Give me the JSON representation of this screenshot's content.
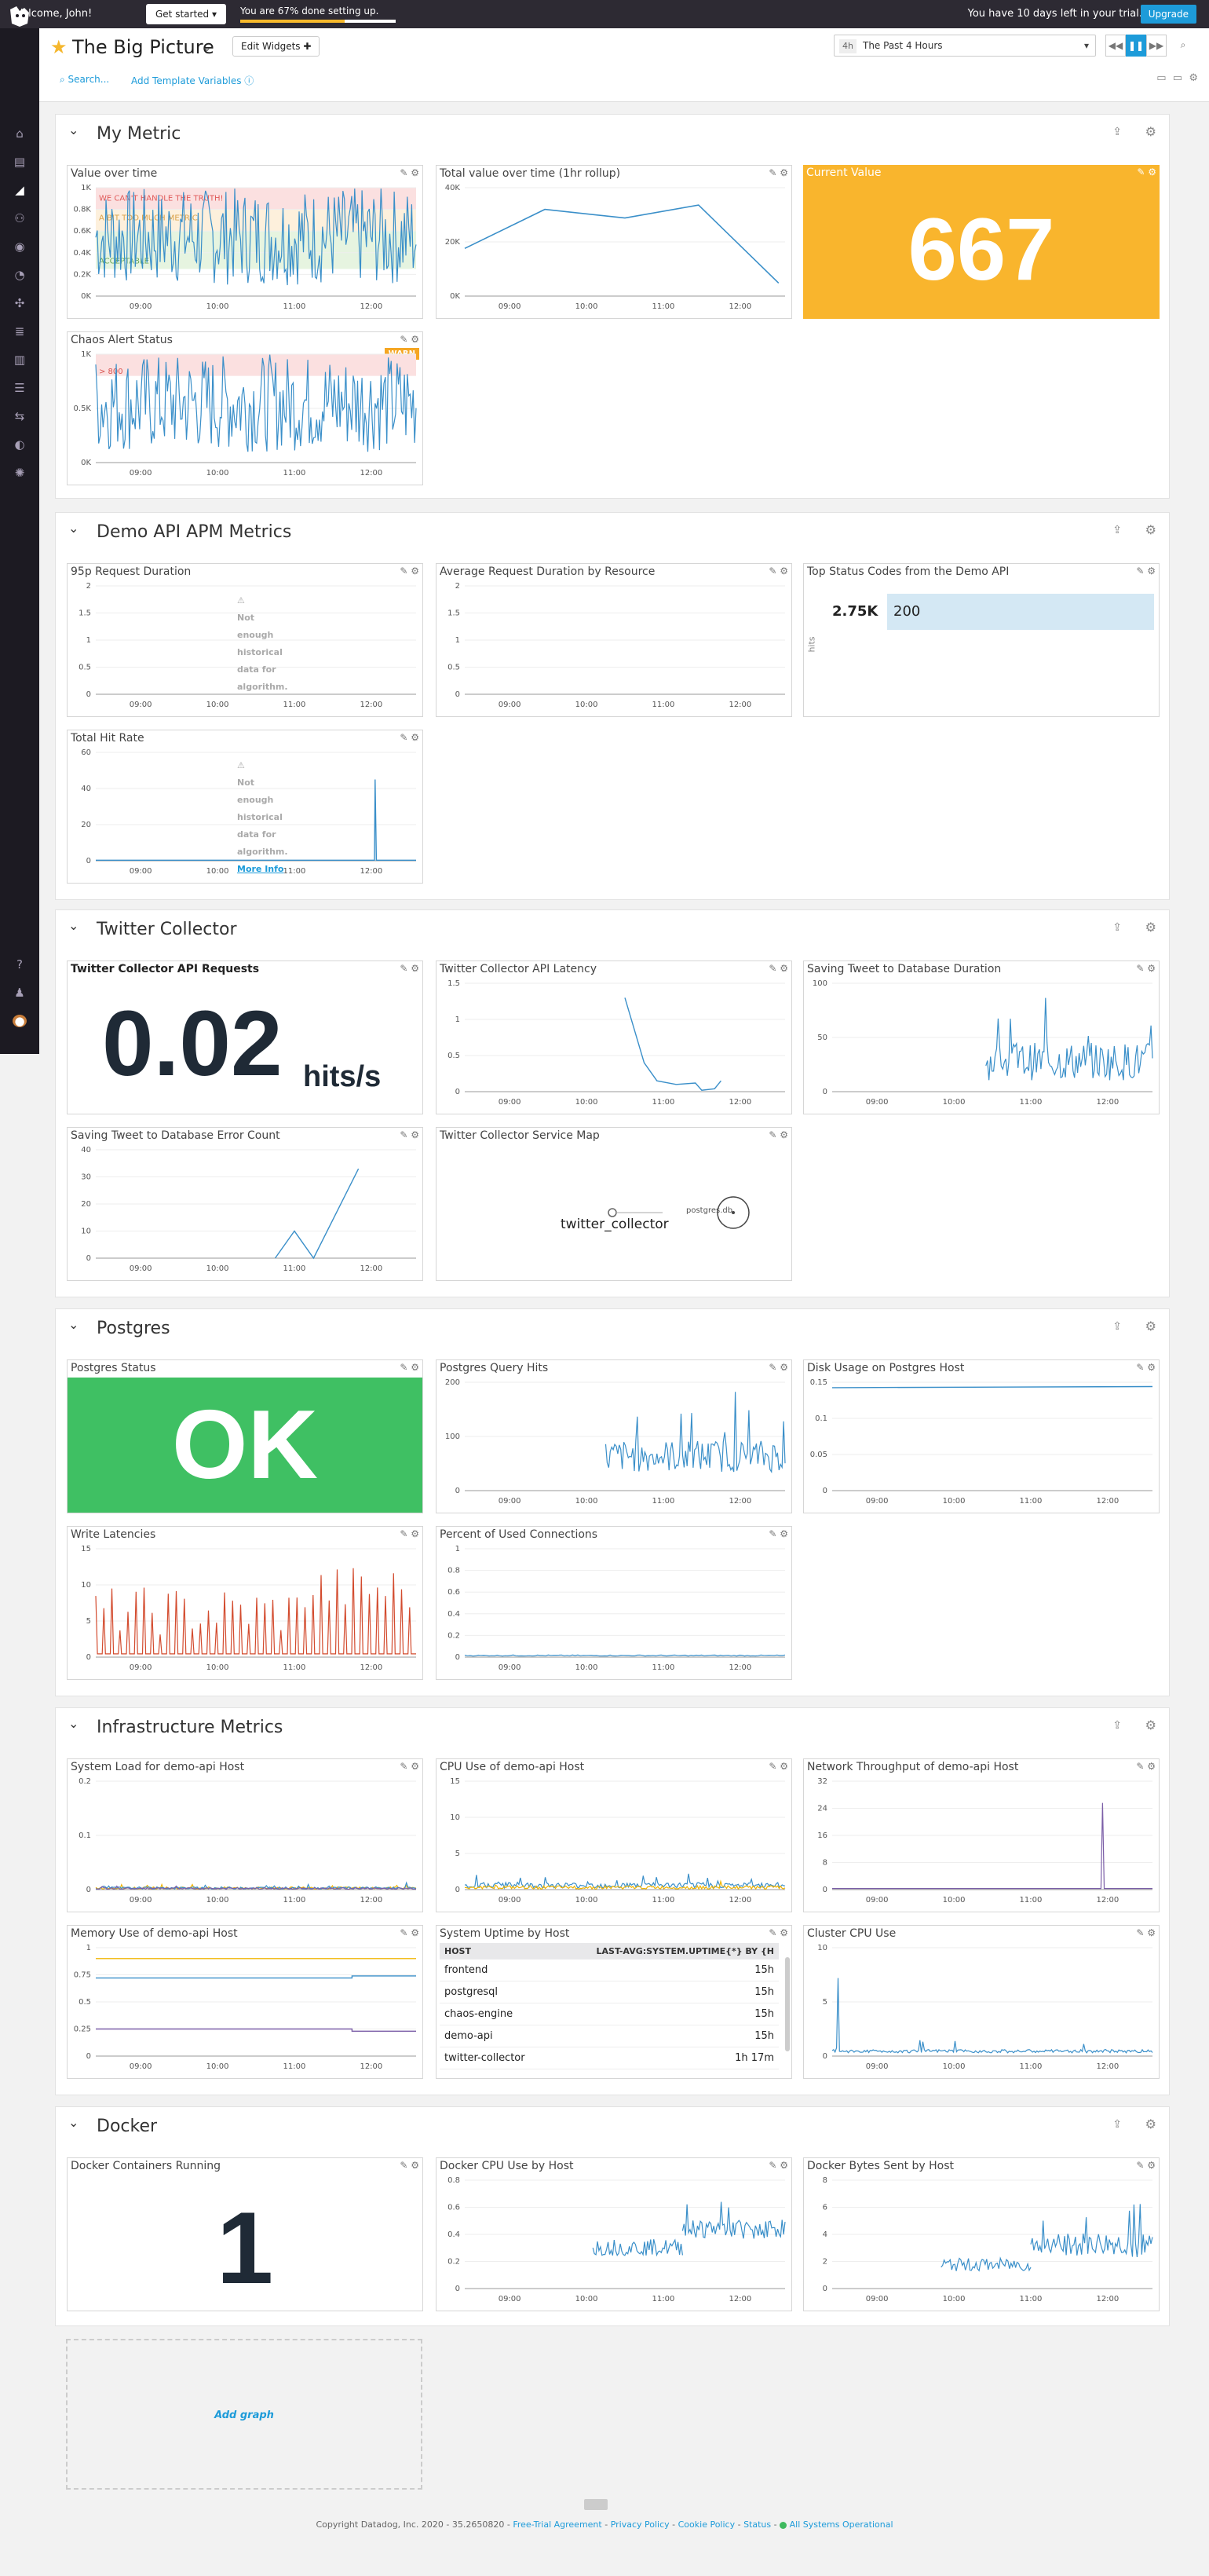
{
  "topbar": {
    "welcome": "Welcome, John!",
    "get_started": "Get started ▾",
    "progress_text": "You are 67% done setting up.",
    "progress_fraction": 0.67,
    "trial_text": "You have 10 days left in your trial.",
    "upgrade": "Upgrade"
  },
  "header": {
    "title": "The Big Picture",
    "edit_widgets": "Edit Widgets ✚",
    "time_code": "4h",
    "time_range": "The Past 4 Hours",
    "search": "Search...",
    "add_template": "Add Template Variables"
  },
  "time_ticks": [
    "09:00",
    "10:00",
    "11:00",
    "12:00"
  ],
  "groups": {
    "my_metric": {
      "title": "My Metric",
      "value_over_time": {
        "title": "Value over time",
        "yticks": [
          "1K",
          "0.8K",
          "0.6K",
          "0.4K",
          "0.2K",
          "0K"
        ],
        "markers": [
          "WE CAN'T HANDLE THE TRUTH!",
          "A BIT TOO MUCH METRIC",
          "ACCEPTABLE"
        ]
      },
      "total_value": {
        "title": "Total value over time (1hr rollup)",
        "yticks": [
          "40K",
          "20K",
          "0K"
        ],
        "points": [
          22000,
          40000,
          36000,
          42000,
          6000
        ]
      },
      "current_value": {
        "title": "Current Value",
        "value": "667",
        "color": "#f9b52d"
      },
      "chaos_alert": {
        "title": "Chaos Alert Status",
        "badge": "WARN",
        "threshold": "> 800",
        "yticks": [
          "1K",
          "0.5K",
          "0K"
        ]
      }
    },
    "demo_api": {
      "title": "Demo API APM Metrics",
      "p95": {
        "title": "95p Request Duration",
        "yticks": [
          "2",
          "1.5",
          "1",
          "0.5",
          "0"
        ],
        "notice": "Not enough historical data for algorithm.",
        "notice_link": "More Info"
      },
      "avg_resource": {
        "title": "Average Request Duration by Resource",
        "yticks": [
          "2",
          "1.5",
          "1",
          "0.5",
          "0"
        ]
      },
      "top_status": {
        "title": "Top Status Codes from the Demo API",
        "count": "2.75K",
        "code": "200",
        "axis_label": "hits"
      },
      "total_hit": {
        "title": "Total Hit Rate",
        "yticks": [
          "60",
          "40",
          "20",
          "0"
        ],
        "notice": "Not enough historical data for algorithm.",
        "notice_link": "More Info"
      }
    },
    "twitter": {
      "title": "Twitter Collector",
      "api_requests": {
        "title": "Twitter Collector API Requests",
        "value": "0.02",
        "unit": "hits/s"
      },
      "api_latency": {
        "title": "Twitter Collector API Latency",
        "yticks": [
          "1.5",
          "1",
          "0.5",
          "0"
        ]
      },
      "saving_duration": {
        "title": "Saving Tweet to Database Duration",
        "yticks": [
          "100",
          "50",
          "0"
        ]
      },
      "error_count": {
        "title": "Saving Tweet to Database Error Count",
        "yticks": [
          "40",
          "30",
          "20",
          "10",
          "0"
        ]
      },
      "service_map": {
        "title": "Twitter Collector Service Map",
        "node_a": "twitter_collector",
        "node_b": "postgres.db"
      }
    },
    "postgres": {
      "title": "Postgres",
      "status": {
        "title": "Postgres Status",
        "value": "OK",
        "color": "#3fc063"
      },
      "query_hits": {
        "title": "Postgres Query Hits",
        "yticks": [
          "200",
          "100",
          "0"
        ]
      },
      "disk_usage": {
        "title": "Disk Usage on Postgres Host",
        "yticks": [
          "0.15",
          "0.1",
          "0.05",
          "0"
        ]
      },
      "write_latencies": {
        "title": "Write Latencies",
        "yticks": [
          "15",
          "10",
          "5",
          "0"
        ]
      },
      "used_connections": {
        "title": "Percent of Used Connections",
        "yticks": [
          "1",
          "0.8",
          "0.6",
          "0.4",
          "0.2",
          "0"
        ]
      }
    },
    "infra": {
      "title": "Infrastructure Metrics",
      "system_load": {
        "title": "System Load for demo-api Host",
        "yticks": [
          "0.2",
          "0.1",
          "0"
        ]
      },
      "cpu_use": {
        "title": "CPU Use of demo-api Host",
        "yticks": [
          "15",
          "10",
          "5",
          "0"
        ]
      },
      "network": {
        "title": "Network Throughput of demo-api Host",
        "yticks": [
          "32",
          "24",
          "16",
          "8",
          "0"
        ]
      },
      "memory": {
        "title": "Memory Use of demo-api Host",
        "yticks": [
          "1",
          "0.75",
          "0.5",
          "0.25",
          "0"
        ]
      },
      "uptime": {
        "title": "System Uptime by Host",
        "col_host": "HOST",
        "col_value": "LAST-AVG:SYSTEM.UPTIME{*} BY {H",
        "rows": [
          {
            "host": "frontend",
            "value": "15h"
          },
          {
            "host": "postgresql",
            "value": "15h"
          },
          {
            "host": "chaos-engine",
            "value": "15h"
          },
          {
            "host": "demo-api",
            "value": "15h"
          },
          {
            "host": "twitter-collector",
            "value": "1h 17m"
          }
        ]
      },
      "cluster_cpu": {
        "title": "Cluster CPU Use",
        "yticks": [
          "10",
          "5",
          "0"
        ]
      }
    },
    "docker": {
      "title": "Docker",
      "containers": {
        "title": "Docker Containers Running",
        "value": "1"
      },
      "cpu": {
        "title": "Docker CPU Use by Host",
        "yticks": [
          "0.8",
          "0.6",
          "0.4",
          "0.2",
          "0"
        ]
      },
      "bytes": {
        "title": "Docker Bytes Sent by Host",
        "yticks": [
          "8",
          "6",
          "4",
          "2",
          "0"
        ]
      }
    }
  },
  "add_graph": "Add graph",
  "footer": {
    "copyright": "Copyright Datadog, Inc. 2020 - 35.2650820 -",
    "link1": "Free-Trial Agreement",
    "link2": "Privacy Policy",
    "link3": "Cookie Policy",
    "link4": "Status",
    "status": "All Systems Operational"
  }
}
